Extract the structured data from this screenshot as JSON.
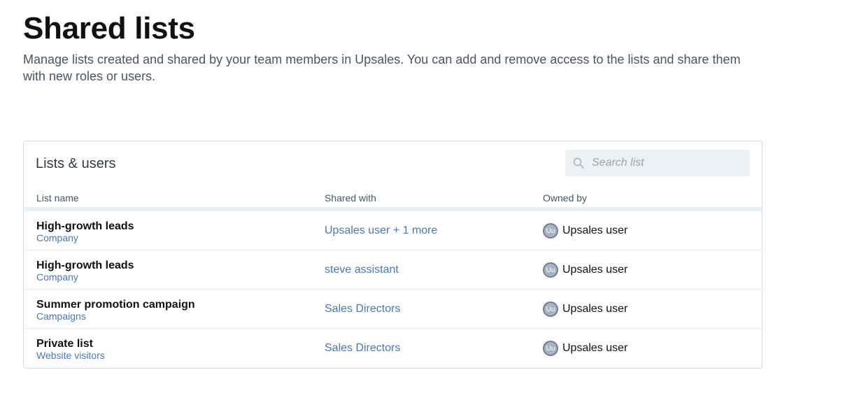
{
  "page": {
    "title": "Shared lists",
    "description": "Manage lists created and shared by your team members in Upsales. You can add and remove access to the lists and share them with new roles or users."
  },
  "card": {
    "title": "Lists & users",
    "search": {
      "placeholder": "Search list",
      "value": ""
    },
    "columns": [
      "List name",
      "Shared with",
      "Owned by"
    ],
    "rows": [
      {
        "name": "High-growth leads",
        "type": "Company",
        "shared_with": "Upsales user + 1 more",
        "owner_initials": "Uu",
        "owner": "Upsales user"
      },
      {
        "name": "High-growth leads",
        "type": "Company",
        "shared_with": "steve assistant",
        "owner_initials": "Uu",
        "owner": "Upsales user"
      },
      {
        "name": "Summer promotion campaign",
        "type": "Campaigns",
        "shared_with": "Sales Directors",
        "owner_initials": "Uu",
        "owner": "Upsales user"
      },
      {
        "name": "Private list",
        "type": "Website visitors",
        "shared_with": "Sales Directors",
        "owner_initials": "Uu",
        "owner": "Upsales user"
      }
    ]
  },
  "colors": {
    "link": "#4a78b8",
    "search_bg": "#edf1f4",
    "avatar_bg": "#a8b3c2"
  },
  "icons": {
    "search": "search-icon"
  }
}
